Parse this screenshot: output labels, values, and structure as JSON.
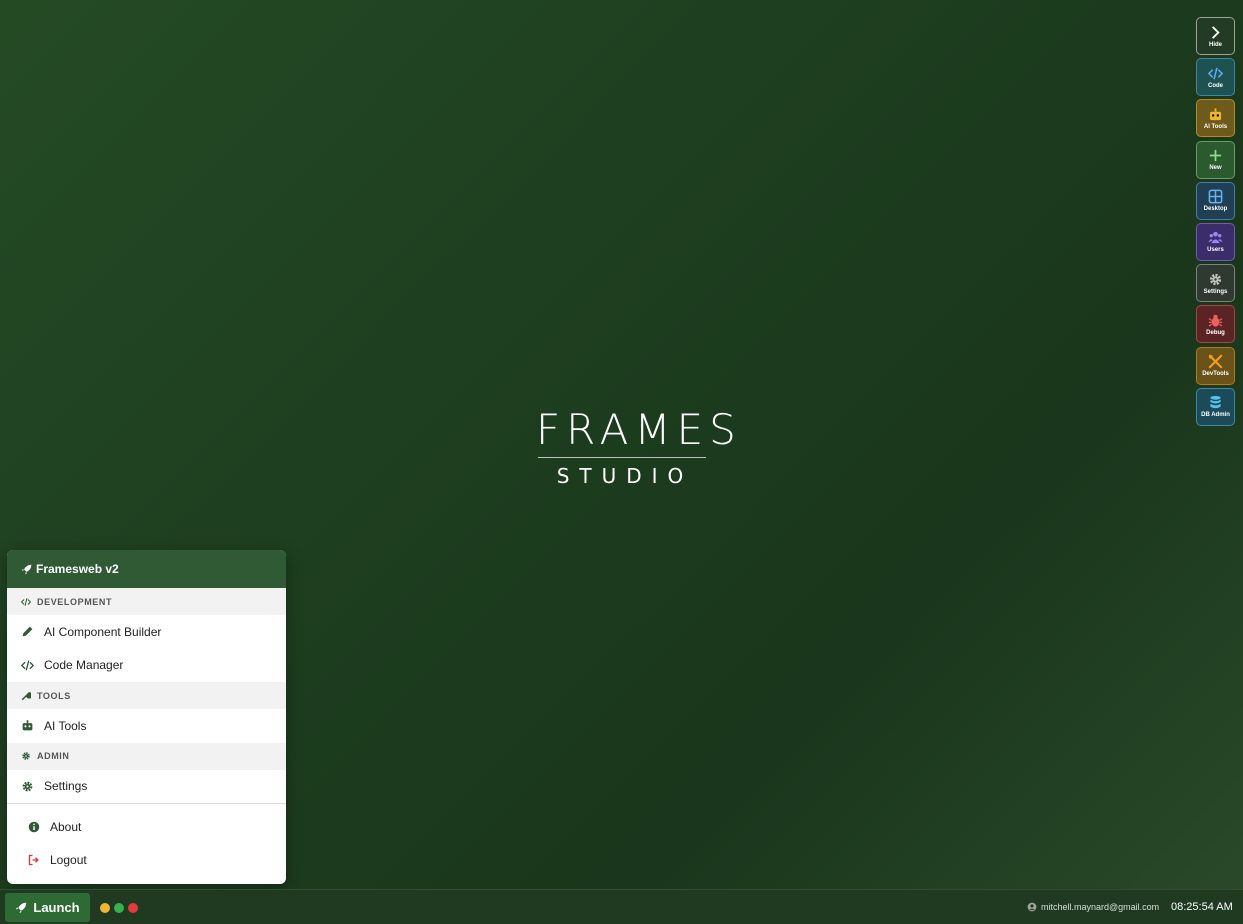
{
  "logo": {
    "main": "FRAMES",
    "sub": "STUDIO"
  },
  "dock": [
    {
      "label": "Hide",
      "icon": "chevron-right-icon",
      "bg": "#233a25",
      "fg": "#ffffff"
    },
    {
      "label": "Code",
      "icon": "code-icon",
      "bg": "#1e5250",
      "fg": "#5ab0ff"
    },
    {
      "label": "AI Tools",
      "icon": "robot-icon",
      "bg": "#6e5a1a",
      "fg": "#f0b52b"
    },
    {
      "label": "New",
      "icon": "plus-icon",
      "bg": "#2a5a2e",
      "fg": "#8fe08f"
    },
    {
      "label": "Desktop",
      "icon": "grid-icon",
      "bg": "#203f55",
      "fg": "#64b5f6"
    },
    {
      "label": "Users",
      "icon": "users-icon",
      "bg": "#3a2d6a",
      "fg": "#9a85f5"
    },
    {
      "label": "Settings",
      "icon": "gear-icon",
      "bg": "#2e3a30",
      "fg": "#c0c4c0"
    },
    {
      "label": "Debug",
      "icon": "bug-icon",
      "bg": "#5a2424",
      "fg": "#f06060"
    },
    {
      "label": "DevTools",
      "icon": "tools-icon",
      "bg": "#6a5218",
      "fg": "#f29b25"
    },
    {
      "label": "DB Admin",
      "icon": "database-icon",
      "bg": "#1c4a58",
      "fg": "#54c3f0"
    }
  ],
  "menu": {
    "title": "Framesweb v2",
    "sections": {
      "development": "DEVELOPMENT",
      "tools": "TOOLS",
      "admin": "ADMIN"
    },
    "items": {
      "ai_component_builder": "AI Component Builder",
      "code_manager": "Code Manager",
      "ai_tools": "AI Tools",
      "settings": "Settings",
      "about": "About",
      "logout": "Logout"
    }
  },
  "taskbar": {
    "launch": "Launch",
    "dots": [
      "#f2b434",
      "#35b34a",
      "#e03c3c"
    ],
    "user_email": "mitchell.maynard@gmail.com",
    "time": "08:25:54 AM"
  }
}
